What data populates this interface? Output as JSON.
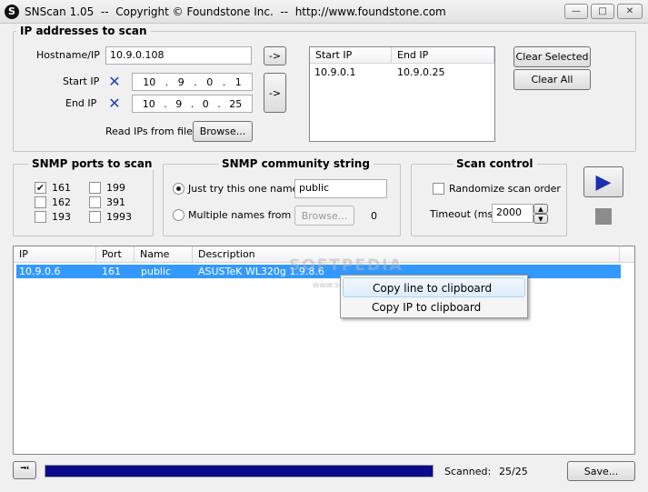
{
  "window": {
    "app_icon_letter": "S",
    "title": "SNScan 1.05  --  Copyright © Foundstone Inc.  --  http://www.foundstone.com",
    "minimize_glyph": "—",
    "maximize_glyph": "□",
    "close_glyph": "✕"
  },
  "ip_group": {
    "title": "IP addresses to scan",
    "hostname_label": "Hostname/IP",
    "hostname_value": "10.9.0.108",
    "add_host_button": "->",
    "start_ip_label": "Start IP",
    "start_ip": [
      "10",
      "9",
      "0",
      "1"
    ],
    "end_ip_label": "End IP",
    "end_ip": [
      "10",
      "9",
      "0",
      "25"
    ],
    "clear_icon_glyph": "✕",
    "add_range_button": "->",
    "read_file_label": "Read IPs from file",
    "browse_button": "Browse...",
    "range_list": {
      "columns": [
        "Start IP",
        "End IP"
      ],
      "rows": [
        {
          "start": "10.9.0.1",
          "end": "10.9.0.25"
        }
      ]
    },
    "clear_selected_button": "Clear Selected",
    "clear_all_button": "Clear All"
  },
  "snmp_ports": {
    "title": "SNMP ports to scan",
    "ports": [
      {
        "label": "161",
        "checked": true,
        "check_glyph": "✔"
      },
      {
        "label": "199",
        "checked": false
      },
      {
        "label": "162",
        "checked": false
      },
      {
        "label": "391",
        "checked": false
      },
      {
        "label": "193",
        "checked": false
      },
      {
        "label": "1993",
        "checked": false
      }
    ]
  },
  "community": {
    "title": "SNMP community string",
    "option_single": "Just try this one name",
    "single_value": "public",
    "option_multiple": "Multiple names from list",
    "browse_button": "Browse...",
    "names_count": "0"
  },
  "scan_control": {
    "title": "Scan control",
    "randomize_label": "Randomize scan order",
    "timeout_label": "Timeout (ms)",
    "timeout_value": "2000",
    "spin_up_glyph": "▲",
    "spin_down_glyph": "▼",
    "start_glyph": "▶",
    "stop_glyph": "■"
  },
  "results": {
    "columns": [
      "IP",
      "Port",
      "Name",
      "Description"
    ],
    "rows": [
      {
        "ip": "10.9.0.6",
        "port": "161",
        "name": "public",
        "description": "ASUSTeK WL320g 1.9.8.6"
      }
    ]
  },
  "context_menu": {
    "items": [
      "Copy line to clipboard",
      "Copy IP to clipboard"
    ]
  },
  "watermark": {
    "main": "SOFTPEDIA",
    "sub": "www.softpedia.com"
  },
  "status": {
    "pin_glyph": "⭲",
    "progress_fraction": 1.0,
    "scanned_label": "Scanned:",
    "scanned_value": "25/25",
    "save_button": "Save..."
  },
  "colors": {
    "selection": "#3399ff",
    "progress": "#0a0a8a",
    "play": "#1a2fb0",
    "stop": "#8c8c8c"
  }
}
